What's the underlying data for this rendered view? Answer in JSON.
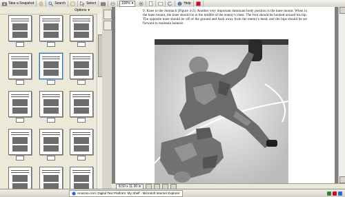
{
  "toolbar": {
    "snapshot_label": "Take a Snapshot",
    "search_label": "Search",
    "select_label": "Select",
    "zoom_value": "100%",
    "help_label": "Help"
  },
  "left_panel": {
    "options_label": "Options"
  },
  "document": {
    "paragraph": "9.  Knee to the Stomach (Figure 4-2). Another very important dominant body position is the knee mount. When in the knee mount, the knee should be in the middle of the enemy's chest. The foot should be hooked around his hip. The opposite knee should be off of the ground and back away from the enemy's head, and the hips should be set forward to maintain balance."
  },
  "status": {
    "page_size": "8.50 x 11.00 in"
  },
  "taskbar": {
    "item_label": "Amazon.com: Digital Text Platform: My Shelf - Microsoft Internet Explorer"
  },
  "colors": {
    "selected_thumb": "#3a6ea5",
    "panel_bg": "#ece9d8"
  }
}
